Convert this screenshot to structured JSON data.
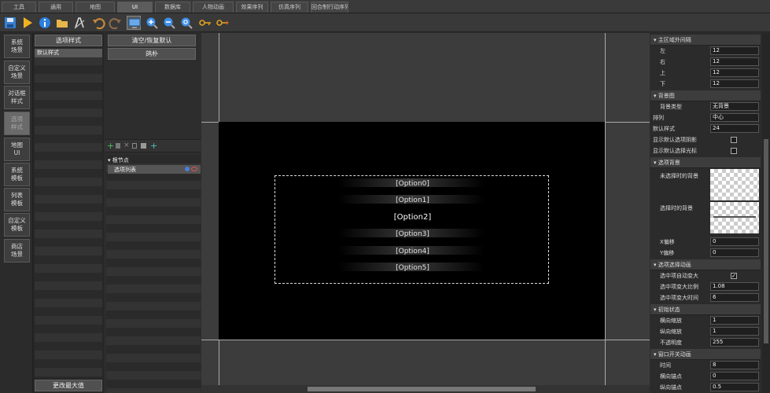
{
  "menu_tabs": [
    "工具",
    "通用",
    "地图",
    "UI",
    "数据库",
    "人物动画",
    "效果序列",
    "仿真序列",
    "回合制行动序列"
  ],
  "active_tab": "UI",
  "side_buttons": [
    "系统\n场景",
    "自定义\n场景",
    "对话框\n样式",
    "选项\n样式",
    "地图\nUI",
    "系统\n模板",
    "列表\n模板",
    "自定义\n模板",
    "商店\n场景"
  ],
  "active_side": 3,
  "list_panel": {
    "header": "选项样式",
    "items": [
      "默认样式"
    ],
    "footer": "更改最大值"
  },
  "mid_panel": {
    "btn_clear": "清空/恢复默认",
    "btn_name": "鸽朴",
    "tree_root": "根节点",
    "tree_child": "选项列表"
  },
  "preview": {
    "options": [
      "[Option0]",
      "[Option1]",
      "[Option2]",
      "[Option3]",
      "[Option4]",
      "[Option5]"
    ],
    "selected_index": 2
  },
  "props": {
    "sec_margin": "主区域外间隔",
    "left_label": "左",
    "left_value": "12",
    "right_label": "右",
    "right_value": "12",
    "top_label": "上",
    "top_value": "12",
    "bottom_label": "下",
    "bottom_value": "12",
    "sec_bg": "背景图",
    "bgtype_label": "背景类型",
    "bgtype_value": "无背景",
    "align_label": "排列",
    "align_value": "中心",
    "default_style_label": "默认样式",
    "default_style_value": "24",
    "show_shadow_label": "显示默认选项阴影",
    "show_cursor_label": "显示默认选择光标",
    "sec_optbg": "选项背景",
    "unselected_bg_label": "未选择时的背景",
    "selected_bg_label": "选择时的背景",
    "xoffset_label": "X偏移",
    "xoffset_value": "0",
    "yoffset_label": "Y偏移",
    "yoffset_value": "0",
    "sec_selanim": "选项选择动画",
    "auto_zoom_label": "选中项自动变大",
    "auto_zoom_checked": "✓",
    "zoom_ratio_label": "选中项变大比例",
    "zoom_ratio_value": "1.08",
    "zoom_time_label": "选中项变大时间",
    "zoom_time_value": "6",
    "sec_init": "初始状态",
    "hscale_label": "横向缩放",
    "hscale_value": "1",
    "vscale_label": "纵向缩放",
    "vscale_value": "1",
    "opacity_label": "不透明度",
    "opacity_value": "255",
    "sec_winanim": "窗口开关动画",
    "time_label": "时间",
    "time_value": "8",
    "hanchor_label": "横向锚点",
    "hanchor_value": "0",
    "vanchor_label": "纵向锚点",
    "vanchor_value": "0.5"
  }
}
